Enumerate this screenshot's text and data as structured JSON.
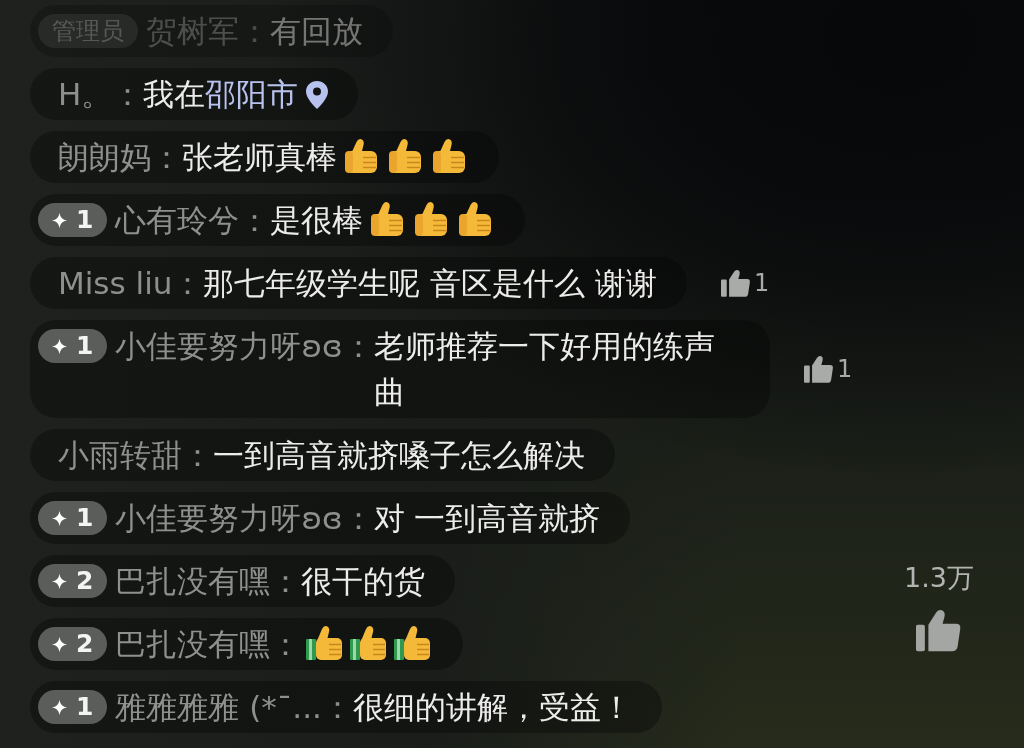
{
  "comments": [
    {
      "badge": {
        "kind": "role",
        "text": "管理员"
      },
      "name": "贺树军：",
      "message": "有回放",
      "faded": true
    },
    {
      "name": "H。：",
      "message": "我在",
      "location": "邵阳市",
      "faded": false
    },
    {
      "name": "朗朗妈：",
      "message": "张老师真棒",
      "emojis": [
        {
          "kind": "plain"
        },
        {
          "kind": "plain"
        },
        {
          "kind": "plain"
        }
      ],
      "faded": false
    },
    {
      "badge": {
        "kind": "level",
        "text": "1"
      },
      "name": "心有玲兮：",
      "message": "是很棒",
      "emojis": [
        {
          "kind": "plain"
        },
        {
          "kind": "plain"
        },
        {
          "kind": "plain"
        }
      ],
      "faded": false
    },
    {
      "name": "Miss liu：",
      "message": "那七年级学生呢 音区是什么 谢谢",
      "likes": "1",
      "faded": false
    },
    {
      "badge": {
        "kind": "level",
        "text": "1"
      },
      "name": "小佳要努力呀ʚɞ：",
      "message": "老师推荐一下好用的练声曲",
      "likes": "1",
      "faded": false
    },
    {
      "name": "小雨转甜：",
      "message": "一到高音就挤嗓子怎么解决",
      "faded": false
    },
    {
      "badge": {
        "kind": "level",
        "text": "1"
      },
      "name": "小佳要努力呀ʚɞ：",
      "message": "对 一到高音就挤",
      "faded": false
    },
    {
      "badge": {
        "kind": "level",
        "text": "2"
      },
      "name": "巴扎没有嘿：",
      "message": "很干的货",
      "faded": false
    },
    {
      "badge": {
        "kind": "level",
        "text": "2"
      },
      "name": "巴扎没有嘿：",
      "emojis": [
        {
          "kind": "cuffed"
        },
        {
          "kind": "cuffed"
        },
        {
          "kind": "cuffed"
        }
      ],
      "faded": false
    },
    {
      "badge": {
        "kind": "level",
        "text": "1"
      },
      "name": "雅雅雅雅 (*¯...：",
      "message": "很细的讲解，受益！",
      "faded": false
    }
  ],
  "like_button": {
    "count": "1.3万"
  }
}
